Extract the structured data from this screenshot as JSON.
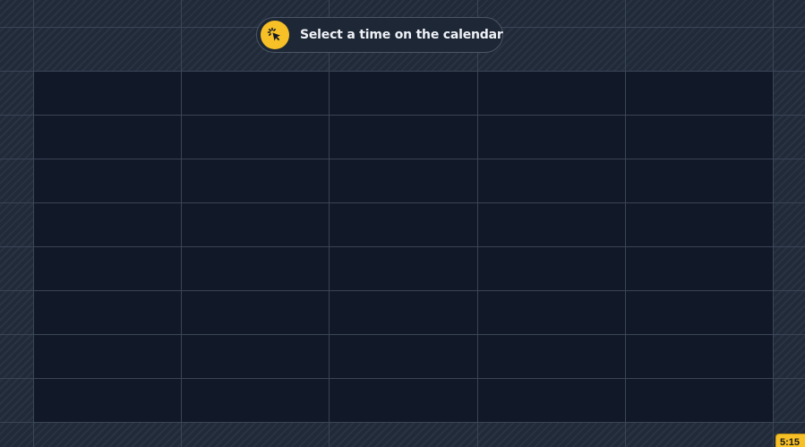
{
  "toast": {
    "message": "Select a time on the calendar",
    "icon": "cursor-click-icon",
    "accent_color": "#f6c026"
  },
  "calendar": {
    "visible_days": 5,
    "visible_slots": 8,
    "time_indicator_label": "5:15",
    "unavailable_style": "hatched",
    "available_color": "#111827",
    "gridline_color": "#3a4556"
  }
}
